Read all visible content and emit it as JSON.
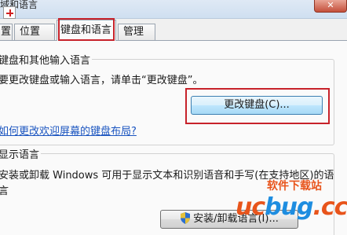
{
  "window": {
    "title": "域和语言",
    "close_glyph": "✕"
  },
  "tabs": [
    {
      "label": "置"
    },
    {
      "label": "位置"
    },
    {
      "label": "键盘和语言"
    },
    {
      "label": "管理"
    }
  ],
  "keyboard_group": {
    "title": "键盘和其他输入语言",
    "description": "要更改键盘或输入语言，请单击“更改键盘”。",
    "button": "更改键盘(C)...",
    "link": "如何更改欢迎屏幕的键盘布局?"
  },
  "display_group": {
    "title": "显示语言",
    "description_line1": "安装或卸载 Windows 可用于显示文本和识别语音和手写(在支持地区)的语",
    "description_line2": "言",
    "button": "安装/卸载语言(I)..."
  },
  "watermark": {
    "logo_a": "uc",
    "logo_b": "bug",
    "logo_c": ".cc",
    "subtitle": "软件下载站"
  },
  "icons": {
    "add": "add-icon",
    "shield": "uac-shield-icon"
  },
  "colors": {
    "highlight": "#c7222a",
    "link": "#1b55c0"
  }
}
